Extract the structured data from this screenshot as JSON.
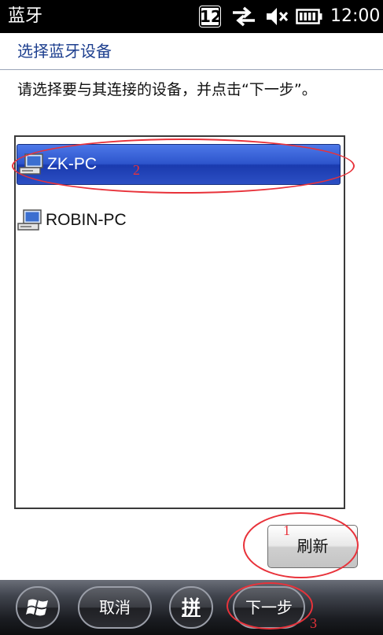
{
  "status_bar": {
    "app_title": "蓝牙",
    "badge": "12",
    "time": "12:00",
    "icons": [
      "calendar-badge-icon",
      "data-sync-icon",
      "volume-muted-icon",
      "battery-icon"
    ]
  },
  "header": {
    "title": "选择蓝牙设备"
  },
  "instruction": "请选择要与其连接的设备，并点击“下一步”。",
  "devices": [
    {
      "label": "ZK-PC",
      "selected": true,
      "icon": "computer-icon"
    },
    {
      "label": "ROBIN-PC",
      "selected": false,
      "icon": "computer-icon"
    }
  ],
  "refresh_button": {
    "label": "刷新"
  },
  "softkeys": {
    "start": {
      "icon": "windows-flag-icon"
    },
    "cancel": "取消",
    "ime": "拼",
    "next": "下一步"
  },
  "annotations": {
    "color": "#e8323a",
    "labels": [
      "1",
      "2",
      "3"
    ]
  },
  "colors": {
    "title_blue": "#1d3f8f",
    "selection_blue": "#2d55cc"
  }
}
